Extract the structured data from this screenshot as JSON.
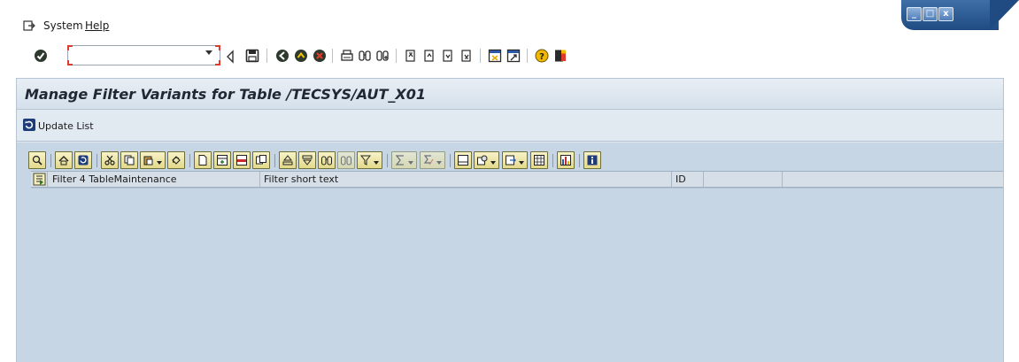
{
  "menubar": {
    "items": [
      {
        "label": "System"
      },
      {
        "label": "Help"
      }
    ]
  },
  "window_controls": {
    "minimize": "_",
    "maximize": "□",
    "close": "x"
  },
  "command_field": {
    "value": "",
    "placeholder": ""
  },
  "title": "Manage Filter Variants for Table /TECSYS/AUT_X01",
  "app_toolbar": {
    "update_list_label": "Update List"
  },
  "grid": {
    "columns": [
      {
        "label": "Filter 4 TableMaintenance"
      },
      {
        "label": "Filter short text"
      },
      {
        "label": "ID"
      }
    ],
    "rows": []
  },
  "colors": {
    "panel_bg": "#dde6ef",
    "content_bg": "#c6d6e5",
    "window_control_blue": "#1f4b82"
  }
}
